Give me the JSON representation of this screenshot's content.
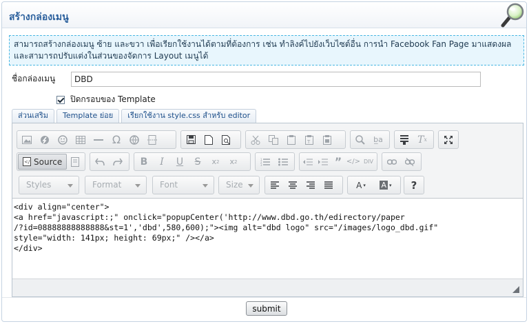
{
  "header": {
    "title": "สร้างกล่องเมนู",
    "icon": "search-icon"
  },
  "notice": {
    "text": "สามารถสร้างกล่องเมนู ซ้าย และขวา เพื่อเรียกใช้งานได้ตามที่ต้องการ เช่น ทำลิงค์ไปยังเว็บไซต์อื่น การนำ Facebook Fan Page มาแสดงผล และสามารถปรับแต่งในส่วนของจัดการ Layout เมนูได้"
  },
  "form": {
    "name_label": "ชื่อกล่องเมนู",
    "name_value": "DBD",
    "checkbox_label": "ปิดกรอบของ Template",
    "checkbox_checked": true
  },
  "tabs": [
    {
      "label": "ส่วนเสริม"
    },
    {
      "label": "Template ย่อย"
    },
    {
      "label": "เรียกใช้งาน style.css สำหรับ editor"
    }
  ],
  "toolbar": {
    "source_label": "Source",
    "styles_label": "Styles",
    "format_label": "Format",
    "font_label": "Font",
    "size_label": "Size",
    "help_label": "?"
  },
  "editor": {
    "lines": [
      "<div align=\"center\">",
      "<a href=\"javascript:;\" onclick=\"popupCenter('http://www.dbd.go.th/edirectory/paper",
      "/?id=08888888888888&st=1','dbd',580,600);\"><img alt=\"dbd logo\" src=\"/images/logo_dbd.gif\"",
      "style=\"width: 141px; height: 69px;\" /></a>",
      "</div>"
    ]
  },
  "submit_label": "submit",
  "colors": {
    "accent": "#2a5f9c",
    "notice_border": "#48b6e2",
    "notice_bg": "#e8f6fd"
  }
}
